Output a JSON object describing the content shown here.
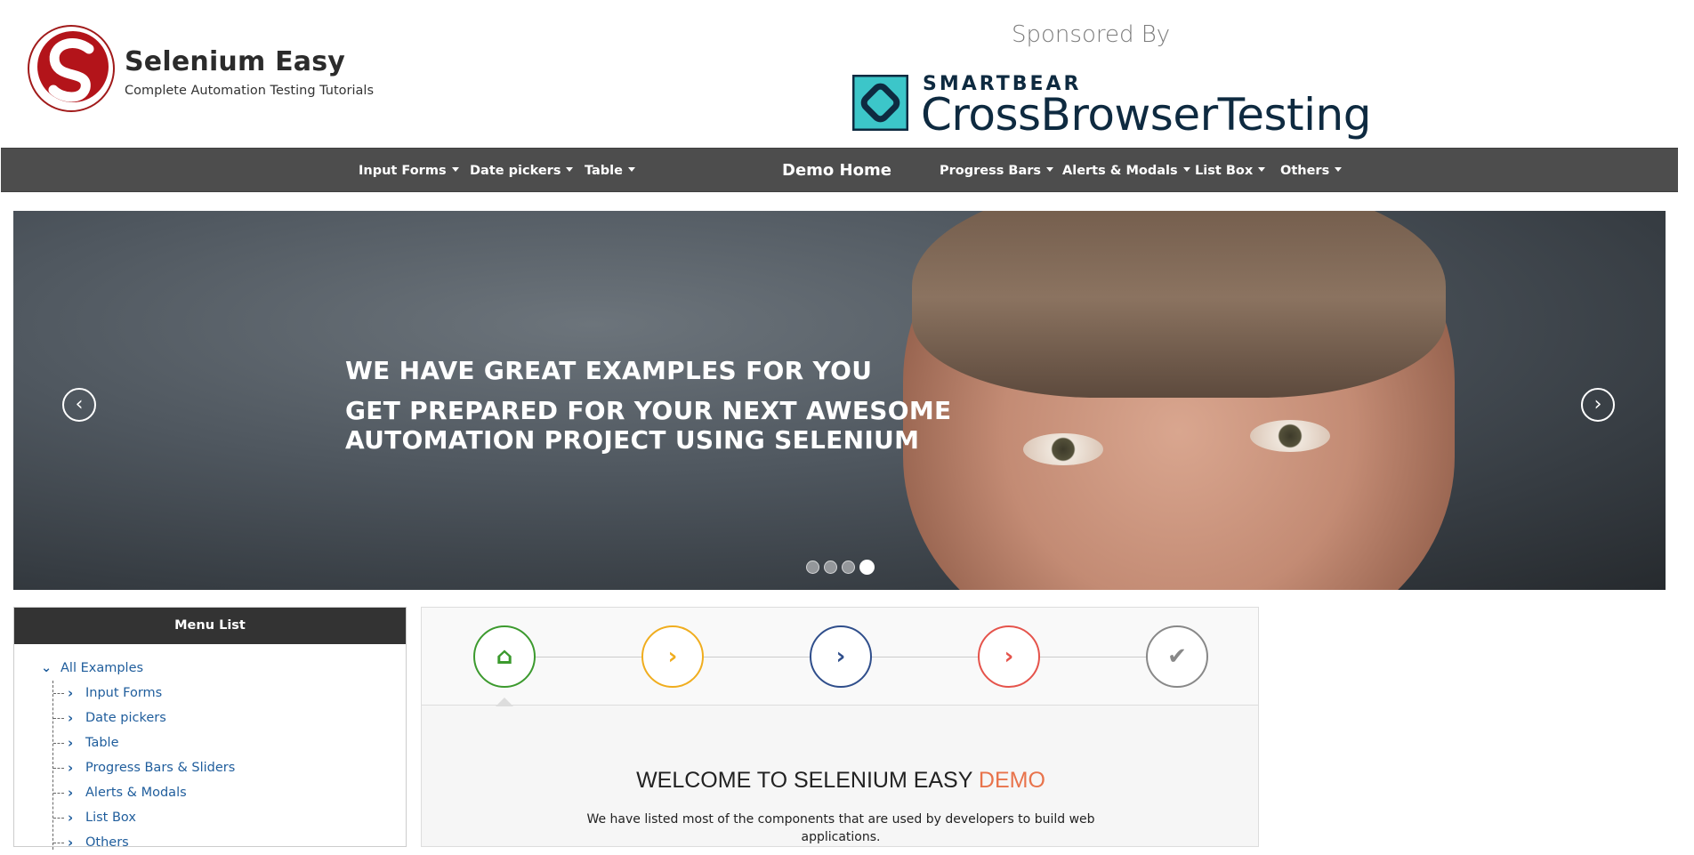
{
  "header": {
    "brand_title": "Selenium Easy",
    "brand_subtitle": "Complete Automation Testing Tutorials",
    "sponsored_label": "Sponsored By",
    "sponsor_top": "SMARTBEAR",
    "sponsor_main": "CrossBrowserTesting"
  },
  "nav": {
    "input_forms": "Input Forms",
    "date_pickers": "Date pickers",
    "table": "Table",
    "demo_home": "Demo Home",
    "progress_bars": "Progress Bars",
    "alerts_modals": "Alerts & Modals",
    "list_box": "List Box",
    "others": "Others"
  },
  "carousel": {
    "heading": "WE HAVE GREAT EXAMPLES FOR YOU",
    "subheading": "GET PREPARED FOR YOUR NEXT AWESOME AUTOMATION PROJECT USING SELENIUM",
    "prev_icon": "‹",
    "next_icon": "›",
    "slide_count": 4,
    "active_slide": 4
  },
  "menu": {
    "title": "Menu List",
    "root": "All Examples",
    "items": [
      "Input Forms",
      "Date pickers",
      "Table",
      "Progress Bars & Sliders",
      "Alerts & Modals",
      "List Box",
      "Others"
    ]
  },
  "wizard": {
    "steps": [
      {
        "icon": "home-icon",
        "color": "#3c9a2e"
      },
      {
        "icon": "chevron-right-icon",
        "color": "#f0ad1e"
      },
      {
        "icon": "chevron-right-icon",
        "color": "#2f4e8b"
      },
      {
        "icon": "chevron-right-icon",
        "color": "#e5534b"
      },
      {
        "icon": "check-icon",
        "color": "#888888"
      }
    ],
    "welcome_main": "WELCOME TO SELENIUM EASY ",
    "welcome_accent": "DEMO",
    "description": "We have listed most of the components that are used by developers to build web applications."
  },
  "colors": {
    "navbar": "#4d4d4d",
    "link": "#1f5d9c",
    "accent": "#e8734b"
  }
}
